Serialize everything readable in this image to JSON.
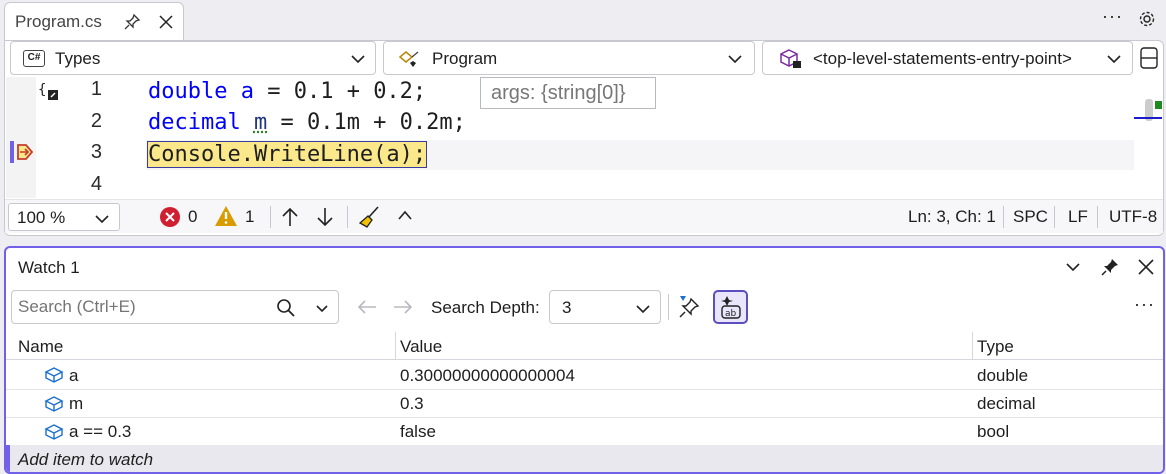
{
  "editor": {
    "tab": {
      "filename": "Program.cs"
    },
    "nav": {
      "types": "Types",
      "members": "Program",
      "entry": "<top-level-statements-entry-point>"
    },
    "lines": [
      {
        "number": "1",
        "kw": "double",
        "ident": "a",
        "rest": " = 0.1 + 0.2;"
      },
      {
        "number": "2",
        "kw": "decimal",
        "ident": "m",
        "rest": " = 0.1m + 0.2m;"
      },
      {
        "number": "3",
        "text": "Console.WriteLine(a);"
      },
      {
        "number": "4"
      }
    ],
    "hint": "args: {string[0]}",
    "status": {
      "zoom": "100 %",
      "errors": "0",
      "warnings": "1",
      "position": "Ln: 3, Ch: 1",
      "whitespace": "SPC",
      "line_ending": "LF",
      "encoding": "UTF-8"
    },
    "colors": {
      "current_line_highlight": "#fbe88a",
      "breakpoint_marker": "#7160e8"
    }
  },
  "watch": {
    "title": "Watch 1",
    "search_placeholder": "Search (Ctrl+E)",
    "search_depth_label": "Search Depth:",
    "search_depth_value": "3",
    "columns": [
      "Name",
      "Value",
      "Type"
    ],
    "rows": [
      {
        "name": "a",
        "value": "0.30000000000000004",
        "type": "double"
      },
      {
        "name": "m",
        "value": "0.3",
        "type": "decimal"
      },
      {
        "name": "a == 0.3",
        "value": "false",
        "type": "bool"
      }
    ],
    "add_item": "Add item to watch"
  }
}
